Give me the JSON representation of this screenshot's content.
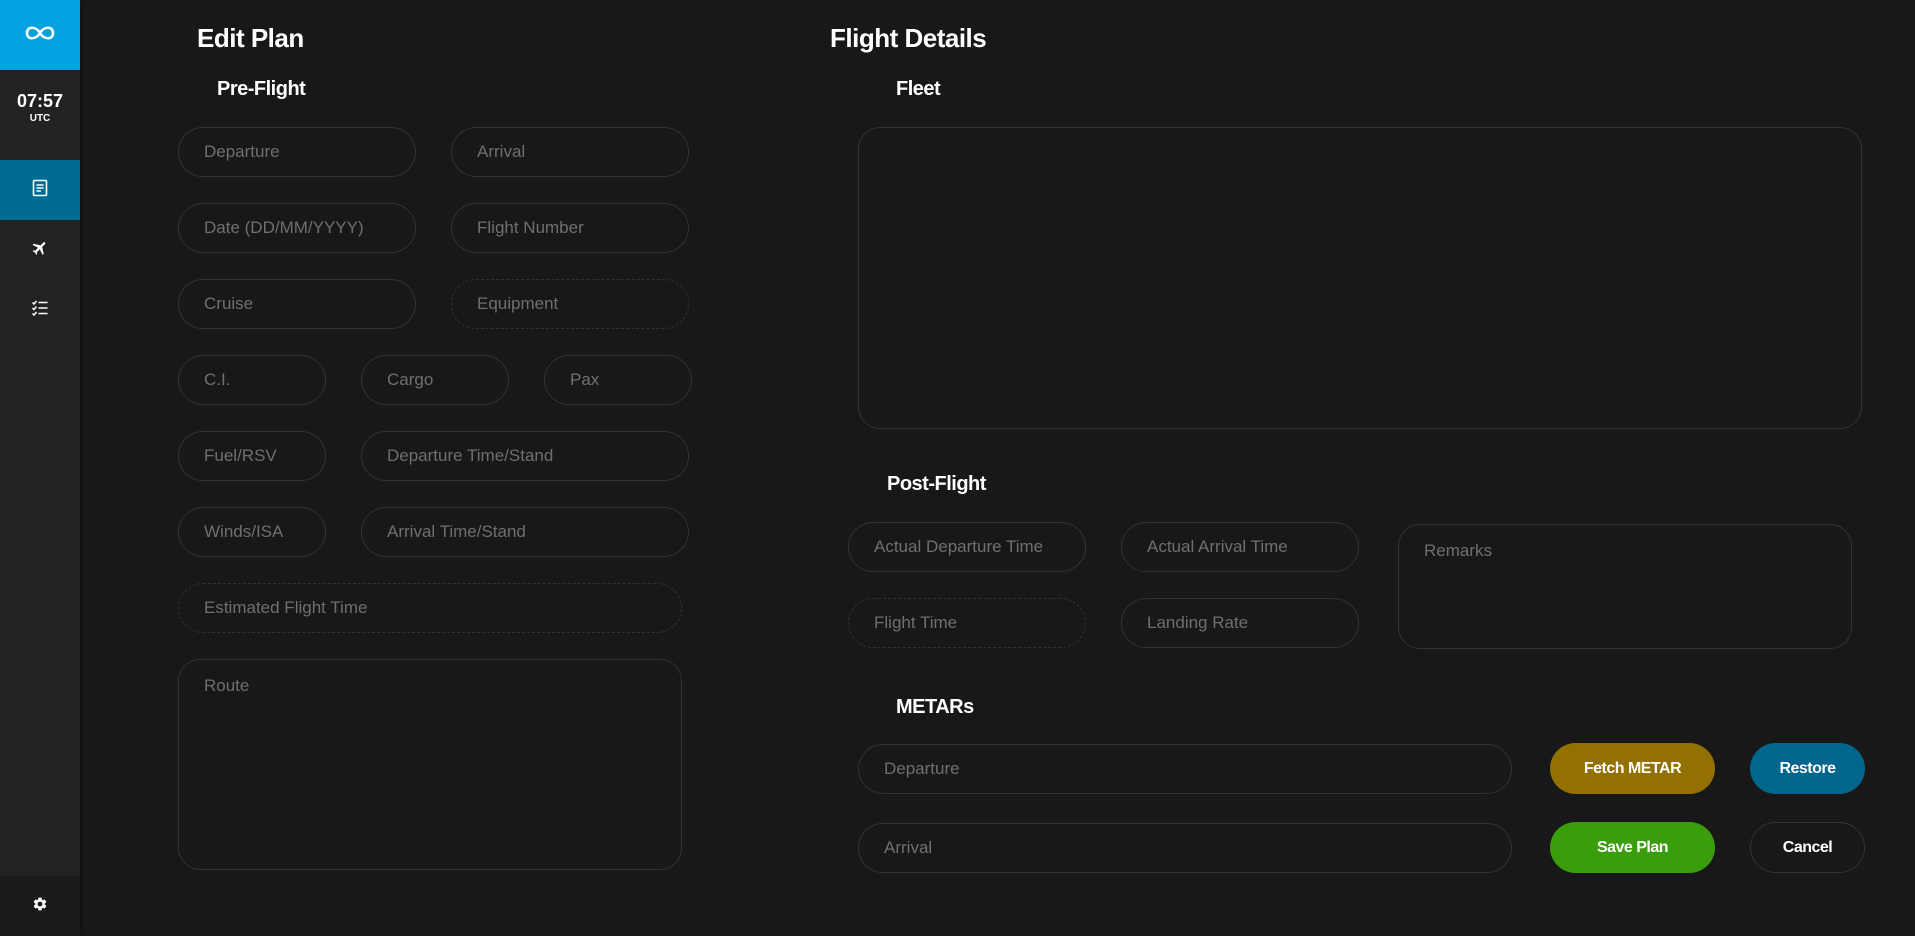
{
  "sidebar": {
    "clock": {
      "time": "07:57",
      "timezone": "UTC"
    },
    "nav": [
      {
        "icon": "logbook-icon",
        "active": true
      },
      {
        "icon": "plane-icon",
        "active": false
      },
      {
        "icon": "checklist-icon",
        "active": false
      }
    ],
    "settings_icon": "gear-icon"
  },
  "colors": {
    "accent": "#00a2e0",
    "active_nav": "#006c94",
    "fetch": "#927001",
    "restore": "#00668e",
    "save": "#3a9d0c"
  },
  "edit_plan": {
    "title": "Edit Plan",
    "preflight": {
      "heading": "Pre-Flight",
      "departure": "Departure",
      "arrival": "Arrival",
      "date": "Date (DD/MM/YYYY)",
      "flight_number": "Flight Number",
      "cruise": "Cruise",
      "equipment": "Equipment",
      "ci": "C.I.",
      "cargo": "Cargo",
      "pax": "Pax",
      "fuel": "Fuel/RSV",
      "departure_time": "Departure Time/Stand",
      "winds": "Winds/ISA",
      "arrival_time": "Arrival Time/Stand",
      "est_flight_time": "Estimated Flight Time",
      "route": "Route"
    }
  },
  "flight_details": {
    "title": "Flight Details",
    "fleet_heading": "Fleet",
    "postflight": {
      "heading": "Post-Flight",
      "actual_departure": "Actual Departure Time",
      "actual_arrival": "Actual Arrival Time",
      "remarks": "Remarks",
      "flight_time": "Flight Time",
      "landing_rate": "Landing Rate"
    },
    "metars": {
      "heading": "METARs",
      "departure": "Departure",
      "arrival": "Arrival"
    },
    "buttons": {
      "fetch": "Fetch METAR",
      "restore": "Restore",
      "save": "Save Plan",
      "cancel": "Cancel"
    }
  }
}
